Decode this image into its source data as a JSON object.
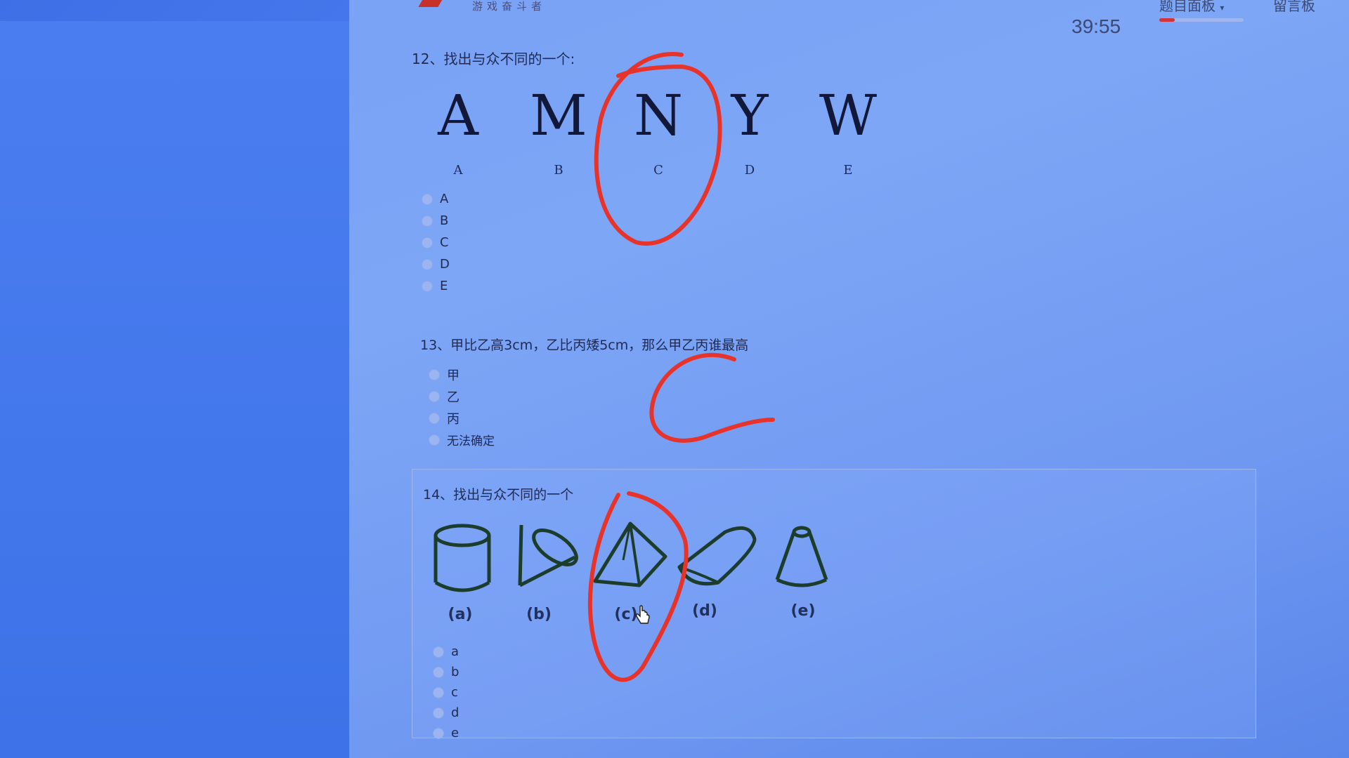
{
  "header": {
    "brand": "游戏奋斗者",
    "timer": "39:55",
    "panel_toggle": "题目面板",
    "message_board": "留言板"
  },
  "questions": [
    {
      "title": "12、找出与众不同的一个:",
      "figures": [
        {
          "letter": "A",
          "caption": "A"
        },
        {
          "letter": "M",
          "caption": "B"
        },
        {
          "letter": "N",
          "caption": "C"
        },
        {
          "letter": "Y",
          "caption": "D"
        },
        {
          "letter": "W",
          "caption": "E"
        }
      ],
      "options": [
        "A",
        "B",
        "C",
        "D",
        "E"
      ]
    },
    {
      "title": "13、甲比乙高3cm，乙比丙矮5cm，那么甲乙丙谁最高",
      "options": [
        "甲",
        "乙",
        "丙",
        "无法确定"
      ]
    },
    {
      "title": "14、找出与众不同的一个",
      "figures": [
        {
          "shape": "cylinder",
          "caption": "(a)"
        },
        {
          "shape": "cone-sideways",
          "caption": "(b)"
        },
        {
          "shape": "pyramid",
          "caption": "(c)"
        },
        {
          "shape": "half-cylinder",
          "caption": "(d)"
        },
        {
          "shape": "truncated-cone",
          "caption": "(e)"
        }
      ],
      "options": [
        "a",
        "b",
        "c",
        "d",
        "e"
      ]
    }
  ],
  "annotation_color": "#e8332b"
}
